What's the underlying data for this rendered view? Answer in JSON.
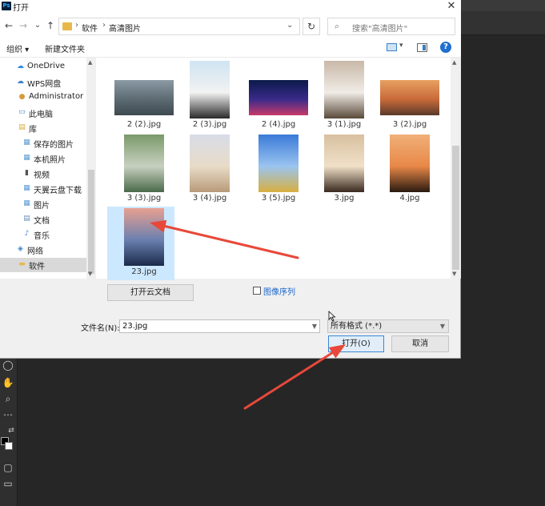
{
  "dialog": {
    "title": "打开",
    "app_icon": "Ps",
    "close_glyph": "✕"
  },
  "nav": {
    "back": "←",
    "forward": "→",
    "dropdown": "⌄",
    "up": "↑",
    "refresh": "↻"
  },
  "breadcrumb": {
    "items": [
      "软件",
      "高清图片"
    ],
    "separator": "›"
  },
  "search": {
    "placeholder": "搜索\"高清图片\""
  },
  "toolbar": {
    "organize": "组织 ▾",
    "new_folder": "新建文件夹",
    "help": "?",
    "view_dropdown": "▾"
  },
  "sidebar": {
    "items": [
      {
        "label": "OneDrive",
        "icon": "cloud-icon",
        "color": "#2f8be6",
        "selected": false
      },
      {
        "label": "WPS网盘",
        "icon": "cloud-icon",
        "color": "#3a7fd4",
        "selected": false
      },
      {
        "label": "Administrator",
        "icon": "user-icon",
        "color": "#d69a3a",
        "selected": false
      },
      {
        "label": "此电脑",
        "icon": "computer-icon",
        "color": "#3b82c4",
        "selected": false
      },
      {
        "label": "库",
        "icon": "library-icon",
        "color": "#d8a93a",
        "selected": false
      },
      {
        "label": "保存的图片",
        "icon": "pictures-icon",
        "color": "#5a9bd5",
        "selected": false
      },
      {
        "label": "本机照片",
        "icon": "pictures-icon",
        "color": "#5a9bd5",
        "selected": false
      },
      {
        "label": "视频",
        "icon": "video-icon",
        "color": "#555555",
        "selected": false
      },
      {
        "label": "天翼云盘下载",
        "icon": "pictures-icon",
        "color": "#5a9bd5",
        "selected": false
      },
      {
        "label": "图片",
        "icon": "pictures-icon",
        "color": "#5a9bd5",
        "selected": false
      },
      {
        "label": "文档",
        "icon": "document-icon",
        "color": "#6a8fb8",
        "selected": false
      },
      {
        "label": "音乐",
        "icon": "music-icon",
        "color": "#3a7fd4",
        "selected": false
      },
      {
        "label": "网络",
        "icon": "network-icon",
        "color": "#3b82c4",
        "selected": false
      },
      {
        "label": "软件",
        "icon": "folder-icon",
        "color": "#e8b94a",
        "selected": true
      }
    ]
  },
  "files": [
    {
      "name": "2 (2).jpg",
      "colors": [
        "#8c9aa4",
        "#5c6a72",
        "#3e4a50"
      ],
      "orientation": "landscape"
    },
    {
      "name": "2 (3).jpg",
      "colors": [
        "#cfe4f2",
        "#f2f2f2",
        "#2a2a2a"
      ],
      "orientation": "portrait"
    },
    {
      "name": "2 (4).jpg",
      "colors": [
        "#0a1a4a",
        "#3a2a8a",
        "#c83a6a"
      ],
      "orientation": "landscape"
    },
    {
      "name": "3 (1).jpg",
      "colors": [
        "#c8b8a8",
        "#f0ece6",
        "#5a4a3a"
      ],
      "orientation": "portrait"
    },
    {
      "name": "3 (2).jpg",
      "colors": [
        "#e8a060",
        "#c86a3a",
        "#5a3a2a"
      ],
      "orientation": "landscape"
    },
    {
      "name": "3 (3).jpg",
      "colors": [
        "#7a9a6a",
        "#c8d0c0",
        "#4a6a4a"
      ],
      "orientation": "portrait"
    },
    {
      "name": "3 (4).jpg",
      "colors": [
        "#d8dce8",
        "#e8dcc8",
        "#b89a78"
      ],
      "orientation": "portrait"
    },
    {
      "name": "3 (5).jpg",
      "colors": [
        "#3a7ad8",
        "#9ac4f0",
        "#d8b040"
      ],
      "orientation": "portrait"
    },
    {
      "name": "3.jpg",
      "colors": [
        "#d8c0a0",
        "#f0e0c8",
        "#3a2a20"
      ],
      "orientation": "portrait"
    },
    {
      "name": "4.jpg",
      "colors": [
        "#f0b078",
        "#e88848",
        "#2a1a10"
      ],
      "orientation": "portrait"
    },
    {
      "name": "23.jpg",
      "colors": [
        "#e8a090",
        "#6a80b0",
        "#1a2a4a"
      ],
      "orientation": "portrait",
      "selected": true
    }
  ],
  "buttons": {
    "open_cloud": "打开云文档",
    "image_sequence": "图像序列",
    "open": "打开(O)",
    "cancel": "取消"
  },
  "filename": {
    "label": "文件名(N):",
    "value": "23.jpg"
  },
  "filter": {
    "value": "所有格式 (*.*)"
  },
  "annotations": {
    "arrow_color": "#e8483a"
  }
}
